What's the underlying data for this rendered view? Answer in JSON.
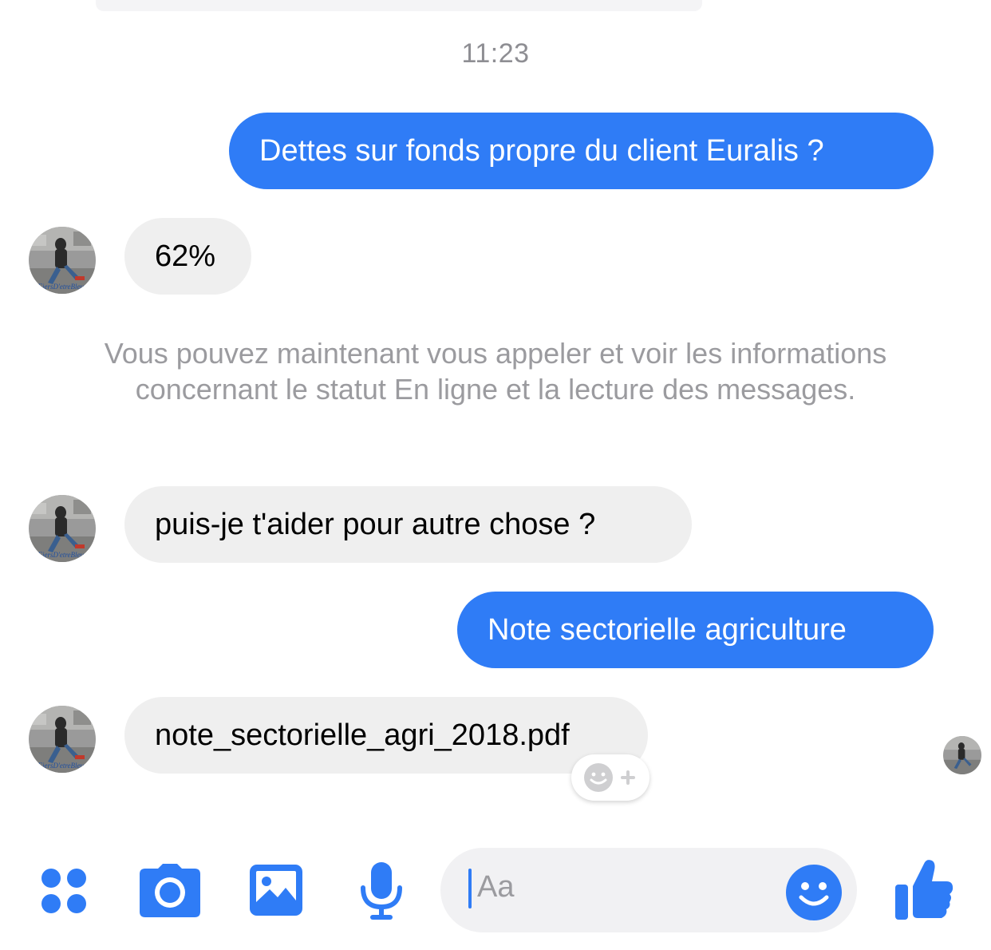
{
  "conversation": {
    "timestamp": "11:23",
    "messages": [
      {
        "direction": "outgoing",
        "text": "Dettes sur fonds propre du client Euralis ?"
      },
      {
        "direction": "incoming",
        "text": "62%"
      },
      {
        "direction": "incoming",
        "text": "puis-je t'aider pour autre chose ?"
      },
      {
        "direction": "outgoing",
        "text": "Note sectorielle agriculture"
      },
      {
        "direction": "incoming",
        "text": "note_sectorielle_agri_2018.pdf"
      }
    ],
    "system_notice": "Vous pouvez maintenant vous appeler et voir les informations concernant le statut En ligne et la lecture des messages."
  },
  "composer": {
    "placeholder": "Aa",
    "icons": [
      "more-apps-icon",
      "camera-icon",
      "gallery-icon",
      "microphone-icon",
      "emoji-icon",
      "thumbs-up-icon"
    ]
  },
  "colors": {
    "accent": "#2f7cf6",
    "incoming_bubble": "#efefef",
    "muted_text": "#9b9b9f"
  }
}
